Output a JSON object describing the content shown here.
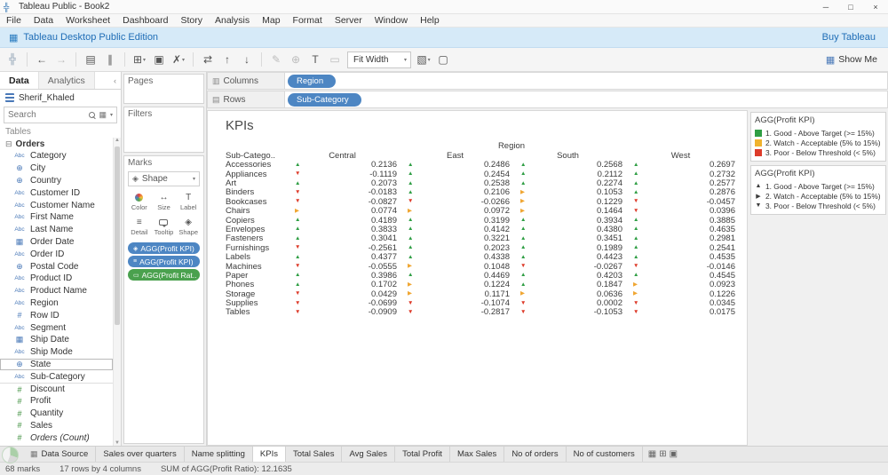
{
  "window": {
    "title": "Tableau Public - Book2",
    "controls": [
      {
        "name": "minimize-button",
        "glyph": "─"
      },
      {
        "name": "maximize-button",
        "glyph": "□"
      },
      {
        "name": "close-button",
        "glyph": "×"
      }
    ]
  },
  "menu": {
    "items": [
      "File",
      "Data",
      "Worksheet",
      "Dashboard",
      "Story",
      "Analysis",
      "Map",
      "Format",
      "Server",
      "Window",
      "Help"
    ]
  },
  "banner": {
    "text": "Tableau Desktop Public Edition",
    "action": "Buy Tableau"
  },
  "toolbar": {
    "fit_label": "Fit Width",
    "show_me_label": "Show Me",
    "icons": [
      {
        "name": "tableau-logo-icon",
        "glyph": "╬",
        "logo": true
      },
      {
        "sep": true
      },
      {
        "name": "undo-icon",
        "glyph": "←"
      },
      {
        "name": "redo-icon",
        "glyph": "→",
        "muted": true
      },
      {
        "sep": true
      },
      {
        "name": "new-datasource-icon",
        "glyph": "▤"
      },
      {
        "name": "pause-updates-icon",
        "glyph": "∥"
      },
      {
        "sep": true
      },
      {
        "name": "new-worksheet-icon",
        "glyph": "⊞",
        "caret": true
      },
      {
        "name": "duplicate-sheet-icon",
        "glyph": "▣"
      },
      {
        "name": "clear-sheet-icon",
        "glyph": "✗",
        "caret": true
      },
      {
        "sep": true
      },
      {
        "name": "swap-rows-columns-icon",
        "glyph": "⇄"
      },
      {
        "name": "sort-ascending-icon",
        "glyph": "↑"
      },
      {
        "name": "sort-descending-icon",
        "glyph": "↓"
      },
      {
        "sep": true
      },
      {
        "name": "highlight-icon",
        "glyph": "✎",
        "muted": true
      },
      {
        "name": "group-members-icon",
        "glyph": "⊕",
        "muted": true
      },
      {
        "name": "show-mark-labels-icon",
        "glyph": "T"
      },
      {
        "name": "fix-axes-icon",
        "glyph": "▭",
        "muted": true
      }
    ],
    "icons_after_fit": [
      {
        "name": "show-hide-cards-icon",
        "glyph": "▧",
        "caret": true
      },
      {
        "name": "presentation-mode-icon",
        "glyph": "▢"
      }
    ]
  },
  "data_pane": {
    "tabs": [
      {
        "label": "Data"
      },
      {
        "label": "Analytics"
      }
    ],
    "source": "Sherif_Khaled",
    "search_placeholder": "Search",
    "section_label": "Tables",
    "folder_label": "Orders",
    "fields": [
      {
        "name": "Category",
        "type": "abc"
      },
      {
        "name": "City",
        "type": "geo"
      },
      {
        "name": "Country",
        "type": "geo"
      },
      {
        "name": "Customer ID",
        "type": "abc"
      },
      {
        "name": "Customer Name",
        "type": "abc"
      },
      {
        "name": "First Name",
        "type": "abc"
      },
      {
        "name": "Last Name",
        "type": "abc"
      },
      {
        "name": "Order Date",
        "type": "date"
      },
      {
        "name": "Order ID",
        "type": "abc"
      },
      {
        "name": "Postal Code",
        "type": "geo"
      },
      {
        "name": "Product ID",
        "type": "abc"
      },
      {
        "name": "Product Name",
        "type": "abc"
      },
      {
        "name": "Region",
        "type": "abc"
      },
      {
        "name": "Row ID",
        "type": "num"
      },
      {
        "name": "Segment",
        "type": "abc"
      },
      {
        "name": "Ship Date",
        "type": "date"
      },
      {
        "name": "Ship Mode",
        "type": "abc"
      },
      {
        "name": "State",
        "type": "geo",
        "focus": true
      },
      {
        "name": "Sub-Category",
        "type": "abc"
      },
      {
        "name": "Discount",
        "type": "num",
        "measure": true,
        "divider": true
      },
      {
        "name": "Profit",
        "type": "num",
        "measure": true
      },
      {
        "name": "Quantity",
        "type": "num",
        "measure": true
      },
      {
        "name": "Sales",
        "type": "num",
        "measure": true
      },
      {
        "name": "Orders (Count)",
        "type": "num",
        "measure": true,
        "italic": true
      }
    ]
  },
  "shelves": {
    "pages_label": "Pages",
    "filters_label": "Filters",
    "marks_label": "Marks",
    "mark_type_label": "Shape",
    "buttons": [
      {
        "label": "Color"
      },
      {
        "label": "Size"
      },
      {
        "label": "Label"
      },
      {
        "label": "Detail"
      },
      {
        "label": "Tooltip"
      },
      {
        "label": "Shape"
      }
    ],
    "pills": [
      {
        "label": "AGG(Profit KPI)",
        "color": "blue",
        "icon_name": "shape-icon",
        "icon_glyph": "◈"
      },
      {
        "label": "AGG(Profit KPI)",
        "color": "blue",
        "icon_name": "detail-icon",
        "icon_glyph": "≡"
      },
      {
        "label": "AGG(Profit Rat..",
        "color": "green",
        "icon_name": "tooltip-icon",
        "icon_glyph": "▭"
      }
    ],
    "columns_label": "Columns",
    "rows_label": "Rows",
    "columns_pill": "Region",
    "rows_pill": "Sub-Category"
  },
  "sheet": {
    "title": "KPIs"
  },
  "chart_data": {
    "type": "table",
    "title": "KPIs",
    "column_dimension": "Region",
    "row_dimension": "Sub-Category",
    "row_header_label": "Sub-Catego..",
    "columns": [
      "Central",
      "East",
      "South",
      "West"
    ],
    "kpi_thresholds": {
      "good_min": 0.15,
      "watch_min": 0.05
    },
    "indicators": {
      "good": {
        "glyph": "▲",
        "color": "#2f9e44"
      },
      "watch": {
        "glyph": "▶",
        "color": "#f0a632"
      },
      "poor": {
        "glyph": "▼",
        "color": "#dd3b2a"
      }
    },
    "rows": [
      {
        "label": "Accessories",
        "values": [
          0.2136,
          0.2486,
          0.2568,
          0.2697
        ]
      },
      {
        "label": "Appliances",
        "values": [
          -0.1119,
          0.2454,
          0.2112,
          0.2732
        ]
      },
      {
        "label": "Art",
        "values": [
          0.2073,
          0.2538,
          0.2274,
          0.2577
        ]
      },
      {
        "label": "Binders",
        "values": [
          -0.0183,
          0.2106,
          0.1053,
          0.2876
        ]
      },
      {
        "label": "Bookcases",
        "values": [
          -0.0827,
          -0.0266,
          0.1229,
          -0.0457
        ]
      },
      {
        "label": "Chairs",
        "values": [
          0.0774,
          0.0972,
          0.1464,
          0.0396
        ]
      },
      {
        "label": "Copiers",
        "values": [
          0.4189,
          0.3199,
          0.3934,
          0.3885
        ]
      },
      {
        "label": "Envelopes",
        "values": [
          0.3833,
          0.4142,
          0.438,
          0.4635
        ]
      },
      {
        "label": "Fasteners",
        "values": [
          0.3041,
          0.3221,
          0.3451,
          0.2981
        ]
      },
      {
        "label": "Furnishings",
        "values": [
          -0.2561,
          0.2023,
          0.1989,
          0.2541
        ]
      },
      {
        "label": "Labels",
        "values": [
          0.4377,
          0.4338,
          0.4423,
          0.4535
        ]
      },
      {
        "label": "Machines",
        "values": [
          -0.0555,
          0.1048,
          -0.0267,
          -0.0146
        ]
      },
      {
        "label": "Paper",
        "values": [
          0.3986,
          0.4469,
          0.4203,
          0.4545
        ]
      },
      {
        "label": "Phones",
        "values": [
          0.1702,
          0.1224,
          0.1847,
          0.0923
        ]
      },
      {
        "label": "Storage",
        "values": [
          0.0429,
          0.1171,
          0.0636,
          0.1226
        ]
      },
      {
        "label": "Supplies",
        "values": [
          -0.0699,
          -0.1074,
          0.0002,
          0.0345
        ]
      },
      {
        "label": "Tables",
        "values": [
          -0.0909,
          -0.2817,
          -0.1053,
          0.0175
        ]
      }
    ]
  },
  "legends": [
    {
      "title": "AGG(Profit KPI)",
      "items": [
        {
          "label": "1. Good - Above Target (>= 15%)",
          "shape": "square",
          "color": "#2f9e44"
        },
        {
          "label": "2. Watch - Acceptable (5% to 15%)",
          "shape": "square",
          "color": "#f0b32e"
        },
        {
          "label": "3. Poor - Below Threshold (< 5%)",
          "shape": "square",
          "color": "#dd3b2a"
        }
      ]
    },
    {
      "title": "AGG(Profit KPI)",
      "items": [
        {
          "label": "1. Good - Above Target (>= 15%)",
          "shape": "triangle-up",
          "color": "#3c3c3c"
        },
        {
          "label": "2. Watch - Acceptable (5% to 15%)",
          "shape": "triangle-right",
          "color": "#3c3c3c"
        },
        {
          "label": "3. Poor - Below Threshold (< 5%)",
          "shape": "triangle-down",
          "color": "#3c3c3c"
        }
      ]
    }
  ],
  "bottom": {
    "data_source_label": "Data Source",
    "tabs": [
      {
        "label": "Sales over quarters"
      },
      {
        "label": "Name splitting"
      },
      {
        "label": "KPIs",
        "active": true
      },
      {
        "label": "Total Sales"
      },
      {
        "label": "Avg Sales"
      },
      {
        "label": "Total Profit"
      },
      {
        "label": "Max Sales"
      },
      {
        "label": "No of orders"
      },
      {
        "label": "No of customers"
      }
    ],
    "new_buttons": [
      {
        "name": "new-worksheet-button",
        "glyph": "▦"
      },
      {
        "name": "new-dashboard-button",
        "glyph": "⊞"
      },
      {
        "name": "new-story-button",
        "glyph": "▣"
      }
    ]
  },
  "status": {
    "marks": "68 marks",
    "dims": "17 rows by 4 columns",
    "agg": "SUM of AGG(Profit Ratio): 12.1635"
  }
}
